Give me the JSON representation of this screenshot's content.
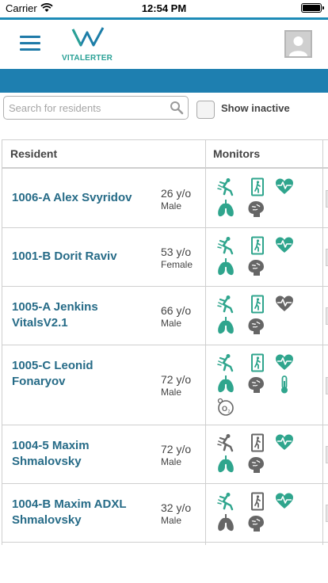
{
  "status_bar": {
    "carrier": "Carrier",
    "time": "12:54 PM"
  },
  "header": {
    "logo_text": "VITALERTER"
  },
  "search": {
    "placeholder": "Search for residents",
    "value": ""
  },
  "show_inactive": {
    "label": "Show inactive",
    "checked": false
  },
  "table": {
    "columns": [
      "Resident",
      "Monitors"
    ],
    "rows": [
      {
        "name": "1006-A Alex Svyridov",
        "age": "26 y/o",
        "sex": "Male",
        "monitors": [
          {
            "icon": "fall-icon",
            "active": true
          },
          {
            "icon": "bed-exit-icon",
            "active": true
          },
          {
            "icon": "heart-icon",
            "active": true
          },
          {
            "icon": "lungs-icon",
            "active": true
          },
          {
            "icon": "brain-icon",
            "active": false
          }
        ]
      },
      {
        "name": "1001-B Dorit Raviv",
        "age": "53 y/o",
        "sex": "Female",
        "monitors": [
          {
            "icon": "fall-icon",
            "active": true
          },
          {
            "icon": "bed-exit-icon",
            "active": true
          },
          {
            "icon": "heart-icon",
            "active": true
          },
          {
            "icon": "lungs-icon",
            "active": true
          },
          {
            "icon": "brain-icon",
            "active": false
          }
        ]
      },
      {
        "name": "1005-A Jenkins VitalsV2.1",
        "age": "66 y/o",
        "sex": "Male",
        "monitors": [
          {
            "icon": "fall-icon",
            "active": true
          },
          {
            "icon": "bed-exit-icon",
            "active": true
          },
          {
            "icon": "heart-icon",
            "active": false
          },
          {
            "icon": "lungs-icon",
            "active": true
          },
          {
            "icon": "brain-icon",
            "active": false
          }
        ]
      },
      {
        "name": "1005-C Leonid Fonaryov",
        "age": "72 y/o",
        "sex": "Male",
        "monitors": [
          {
            "icon": "fall-icon",
            "active": true
          },
          {
            "icon": "bed-exit-icon",
            "active": true
          },
          {
            "icon": "heart-icon",
            "active": true
          },
          {
            "icon": "lungs-icon",
            "active": true
          },
          {
            "icon": "brain-icon",
            "active": false
          },
          {
            "icon": "thermometer-icon",
            "active": true
          },
          {
            "icon": "oxygen-icon",
            "active": false
          }
        ]
      },
      {
        "name": "1004-5 Maxim Shmalovsky",
        "age": "72 y/o",
        "sex": "Male",
        "monitors": [
          {
            "icon": "fall-icon",
            "active": false
          },
          {
            "icon": "bed-exit-icon",
            "active": false
          },
          {
            "icon": "heart-icon",
            "active": true
          },
          {
            "icon": "lungs-icon",
            "active": true
          },
          {
            "icon": "brain-icon",
            "active": false
          }
        ]
      },
      {
        "name": "1004-B Maxim ADXL Shmalovsky",
        "age": "32 y/o",
        "sex": "Male",
        "monitors": [
          {
            "icon": "fall-icon",
            "active": true
          },
          {
            "icon": "bed-exit-icon",
            "active": false
          },
          {
            "icon": "heart-icon",
            "active": true
          },
          {
            "icon": "lungs-icon",
            "active": false
          },
          {
            "icon": "brain-icon",
            "active": false
          }
        ]
      }
    ]
  },
  "colors": {
    "active": "#2fa58d",
    "inactive": "#666666",
    "accent": "#1e7fb0",
    "name": "#266b87"
  }
}
